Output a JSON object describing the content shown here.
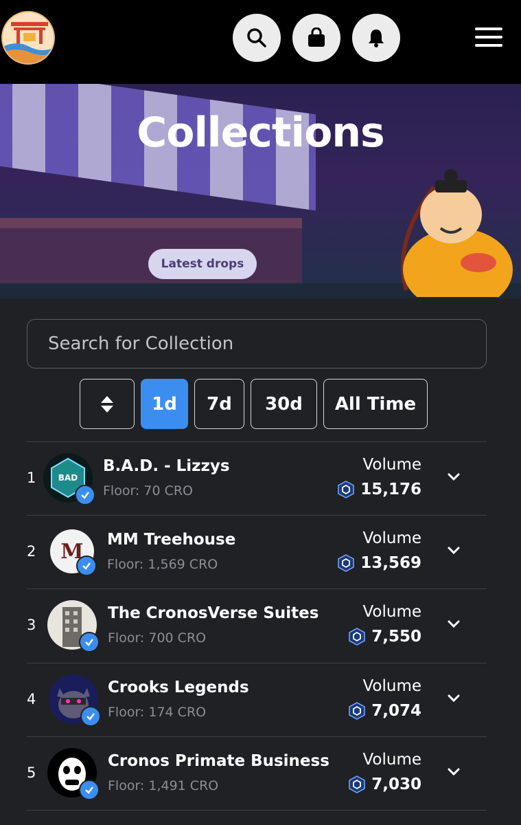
{
  "header": {
    "logo_alt": "marketplace-logo",
    "icons": [
      "search-icon",
      "bag-icon",
      "bell-icon",
      "menu-icon"
    ]
  },
  "banner": {
    "title": "Collections",
    "sign_text": "Latest drops"
  },
  "search": {
    "placeholder": "Search for Collection"
  },
  "filters": {
    "sort_icon": "sort-icon",
    "options": [
      "1d",
      "7d",
      "30d",
      "All Time"
    ],
    "selected": "1d"
  },
  "collections": [
    {
      "rank": "1",
      "name": "B.A.D. - Lizzys",
      "floor": "Floor: 70 CRO",
      "volume_label": "Volume",
      "volume": "15,176"
    },
    {
      "rank": "2",
      "name": "MM Treehouse",
      "floor": "Floor: 1,569 CRO",
      "volume_label": "Volume",
      "volume": "13,569"
    },
    {
      "rank": "3",
      "name": "The CronosVerse Suites",
      "floor": "Floor: 700 CRO",
      "volume_label": "Volume",
      "volume": "7,550"
    },
    {
      "rank": "4",
      "name": "Crooks Legends",
      "floor": "Floor: 174 CRO",
      "volume_label": "Volume",
      "volume": "7,074"
    },
    {
      "rank": "5",
      "name": "Cronos Primate Business",
      "floor": "Floor: 1,491 CRO",
      "volume_label": "Volume",
      "volume": "7,030"
    }
  ],
  "colors": {
    "accent": "#3b8ef0",
    "background": "#1f2125",
    "header": "#000000"
  }
}
